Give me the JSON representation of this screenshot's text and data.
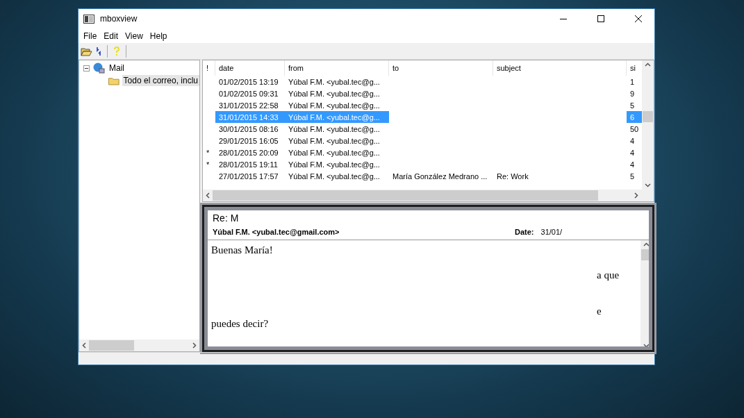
{
  "window": {
    "title": "mboxview"
  },
  "menu": [
    "File",
    "Edit",
    "View",
    "Help"
  ],
  "tree": [
    {
      "label": "Mail",
      "expanded": true,
      "selected": false,
      "children": [
        {
          "label": "Todo el correo, inclu",
          "selected": true
        }
      ]
    }
  ],
  "mail_list": {
    "columns": [
      "!",
      "date",
      "from",
      "to",
      "subject",
      "si"
    ],
    "rows": [
      {
        "date": "01/02/2015 13:19",
        "from": "Yúbal F.M. <yubal.tec@g...",
        "size": "1",
        "selected": false
      },
      {
        "date": "01/02/2015 09:31",
        "from": "Yúbal F.M. <yubal.tec@g...",
        "size": "9",
        "selected": false
      },
      {
        "date": "31/01/2015 22:58",
        "from": "Yúbal F.M. <yubal.tec@g...",
        "size": "5",
        "selected": false
      },
      {
        "date": "31/01/2015 14:33",
        "from": "Yúbal F.M. <yubal.tec@g...",
        "size": "6",
        "selected": true
      },
      {
        "date": "30/01/2015 08:16",
        "from": "Yúbal F.M. <yubal.tec@g...",
        "size": "50",
        "selected": false
      },
      {
        "date": "29/01/2015 16:05",
        "from": "Yúbal F.M. <yubal.tec@g...",
        "size": "4",
        "selected": false
      },
      {
        "flag": "*",
        "date": "28/01/2015 20:09",
        "from": "Yúbal F.M. <yubal.tec@g...",
        "size": "4",
        "selected": false
      },
      {
        "flag": "*",
        "date": "28/01/2015 19:11",
        "from": "Yúbal F.M. <yubal.tec@g...",
        "size": "4",
        "selected": false
      },
      {
        "date": "27/01/2015 17:57",
        "from": "Yúbal F.M. <yubal.tec@g...",
        "to": "María González Medrano ...",
        "subject": "Re: Work",
        "size": "5",
        "selected": false
      }
    ]
  },
  "message": {
    "subject": "Re: M",
    "from": "Yúbal F.M. <yubal.tec@gmail.com>",
    "date_label": "Date:",
    "date": "31/01/",
    "body": [
      {
        "text": "Buenas María!",
        "kind": "line"
      },
      {
        "text": "a que",
        "kind": "line_end"
      },
      {
        "text": "e",
        "kind": "line_end"
      },
      {
        "text": "puedes decir?",
        "kind": "line"
      }
    ]
  }
}
